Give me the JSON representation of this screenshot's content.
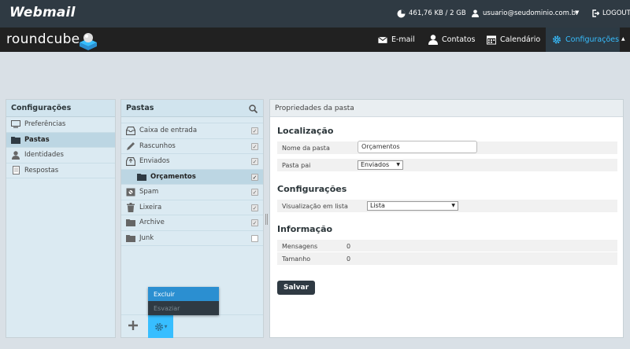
{
  "topbar": {
    "brand": "Webmail",
    "quota": "461,76 KB / 2 GB",
    "user": "usuario@seudominio.com.br",
    "logout": "LOGOUT"
  },
  "logo": {
    "text": "roundcube"
  },
  "nav": {
    "email": "E-mail",
    "contacts": "Contatos",
    "calendar": "Calendário",
    "settings": "Configurações"
  },
  "left": {
    "title": "Configurações",
    "items": [
      {
        "label": "Preferências",
        "icon": "monitor-icon"
      },
      {
        "label": "Pastas",
        "icon": "folder-icon"
      },
      {
        "label": "Identidades",
        "icon": "person-icon"
      },
      {
        "label": "Respostas",
        "icon": "document-icon"
      }
    ]
  },
  "folders": {
    "title": "Pastas",
    "items": [
      {
        "label": "Caixa de entrada",
        "checked": true
      },
      {
        "label": "Rascunhos",
        "checked": true
      },
      {
        "label": "Enviados",
        "checked": true
      },
      {
        "label": "Orçamentos",
        "checked": true
      },
      {
        "label": "Spam",
        "checked": true
      },
      {
        "label": "Lixeira",
        "checked": true
      },
      {
        "label": "Archive",
        "checked": true
      },
      {
        "label": "Junk",
        "checked": false
      }
    ]
  },
  "menu": {
    "delete": "Excluir",
    "empty": "Esvaziar"
  },
  "props": {
    "title": "Propriedades da pasta",
    "location_title": "Localização",
    "folder_name_label": "Nome da pasta",
    "folder_name_value": "Orçamentos",
    "parent_label": "Pasta pai",
    "parent_value": "Enviados",
    "settings_title": "Configurações",
    "list_view_label": "Visualização em lista",
    "list_view_value": "Lista",
    "info_title": "Informação",
    "messages_label": "Mensagens",
    "messages_value": "0",
    "size_label": "Tamanho",
    "size_value": "0",
    "save": "Salvar"
  },
  "colors": {
    "accent": "#37beff",
    "dark": "#2f3a43",
    "menu_hover": "#2b8fd1"
  }
}
